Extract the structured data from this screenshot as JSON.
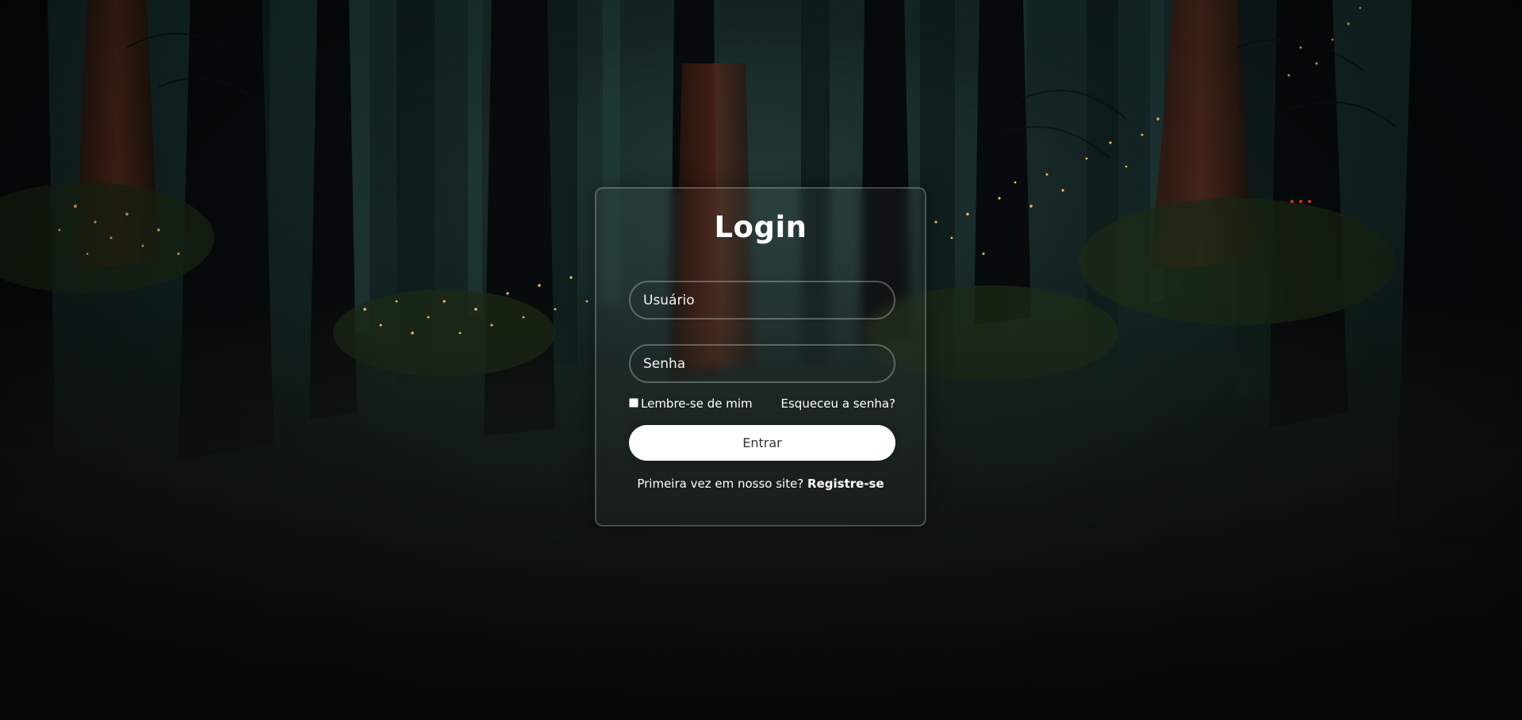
{
  "login": {
    "title": "Login",
    "username_placeholder": "Usuário",
    "password_placeholder": "Senha",
    "remember_label": "Lembre-se de mim",
    "remember_checked": false,
    "forgot_label": "Esqueceu a senha?",
    "submit_label": "Entrar",
    "register_prompt": "Primeira vez em nosso site?",
    "register_link": "Registre-se"
  },
  "colors": {
    "text": "#ffffff",
    "button_bg": "#ffffff",
    "button_text": "#333333",
    "firefly": "#e8b45a"
  }
}
